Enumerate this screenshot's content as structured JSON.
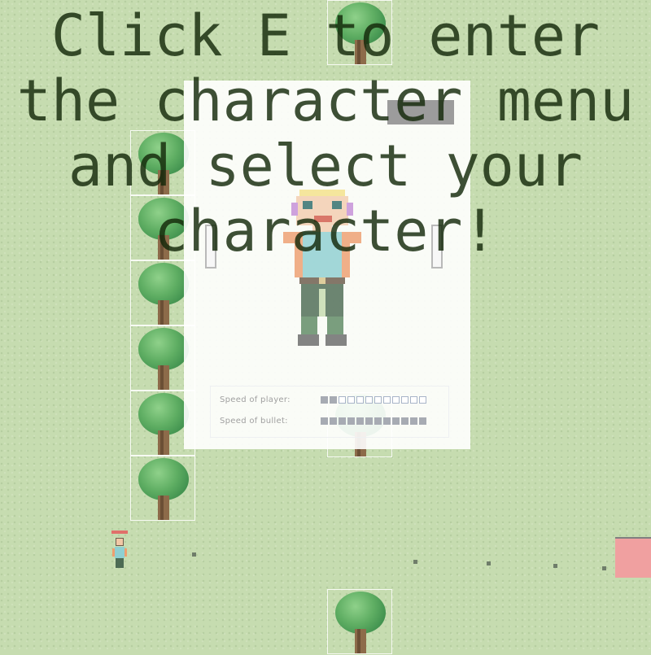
{
  "game": {
    "instruction_text": "Click E to enter the character menu and select your character!"
  },
  "character_menu": {
    "prev_button_icon": "left-arrow-icon",
    "next_button_icon": "right-arrow-icon",
    "stats": [
      {
        "label": "Speed of player:",
        "level": 2,
        "max": 12
      },
      {
        "label": "Speed of bullet:",
        "level": 12,
        "max": 12
      }
    ]
  },
  "colors": {
    "ground": "#c6dcb0",
    "tree_canopy": "#5fae63",
    "enemy": "#f0a0a0",
    "stat_filled": "#a7abb3",
    "stat_empty_border": "#a8b4c8",
    "overlay_text": "#14280a"
  }
}
